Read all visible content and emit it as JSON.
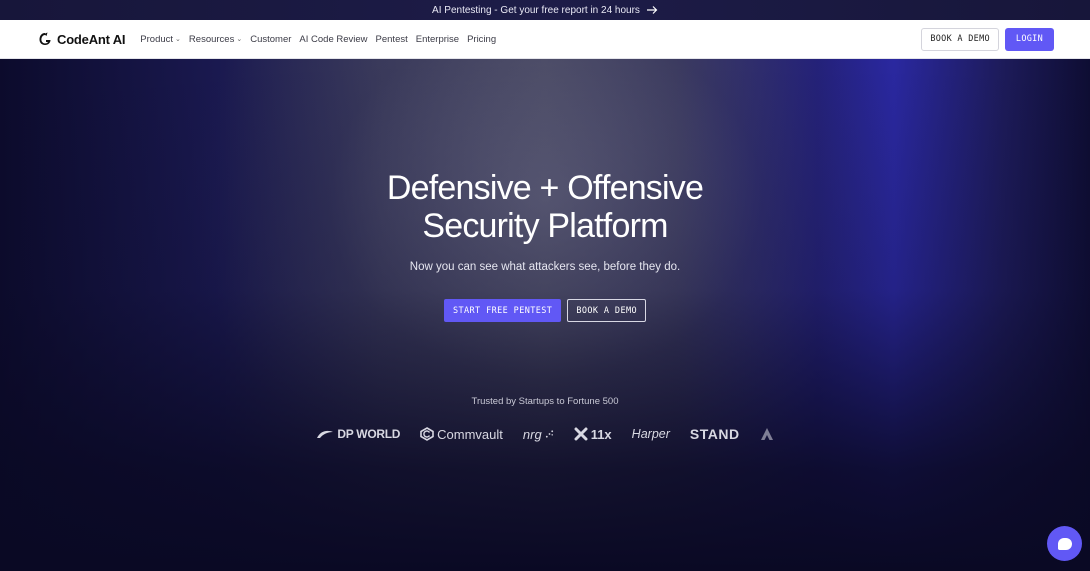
{
  "announcement": {
    "text": "AI Pentesting - Get your free report in 24 hours"
  },
  "nav": {
    "logo_text": "CodeAnt AI",
    "items": [
      {
        "label": "Product",
        "has_dropdown": true
      },
      {
        "label": "Resources",
        "has_dropdown": true
      },
      {
        "label": "Customer",
        "has_dropdown": false
      },
      {
        "label": "AI Code Review",
        "has_dropdown": false
      },
      {
        "label": "Pentest",
        "has_dropdown": false
      },
      {
        "label": "Enterprise",
        "has_dropdown": false
      },
      {
        "label": "Pricing",
        "has_dropdown": false
      }
    ],
    "book_demo": "BOOK A DEMO",
    "login": "LOGIN"
  },
  "hero": {
    "title_line1": "Defensive + Offensive",
    "title_line2": "Security Platform",
    "subtitle": "Now you can see what attackers see, before they do.",
    "cta_primary": "START FREE PENTEST",
    "cta_secondary": "BOOK A DEMO",
    "trusted": "Trusted by Startups to Fortune 500",
    "brands": [
      "DP WORLD",
      "Commvault",
      "nrg",
      "11x",
      "Harper",
      "STAND"
    ]
  },
  "colors": {
    "accent": "#6158f5",
    "nav_bg": "#ffffff",
    "hero_dark": "#0b0a24"
  }
}
